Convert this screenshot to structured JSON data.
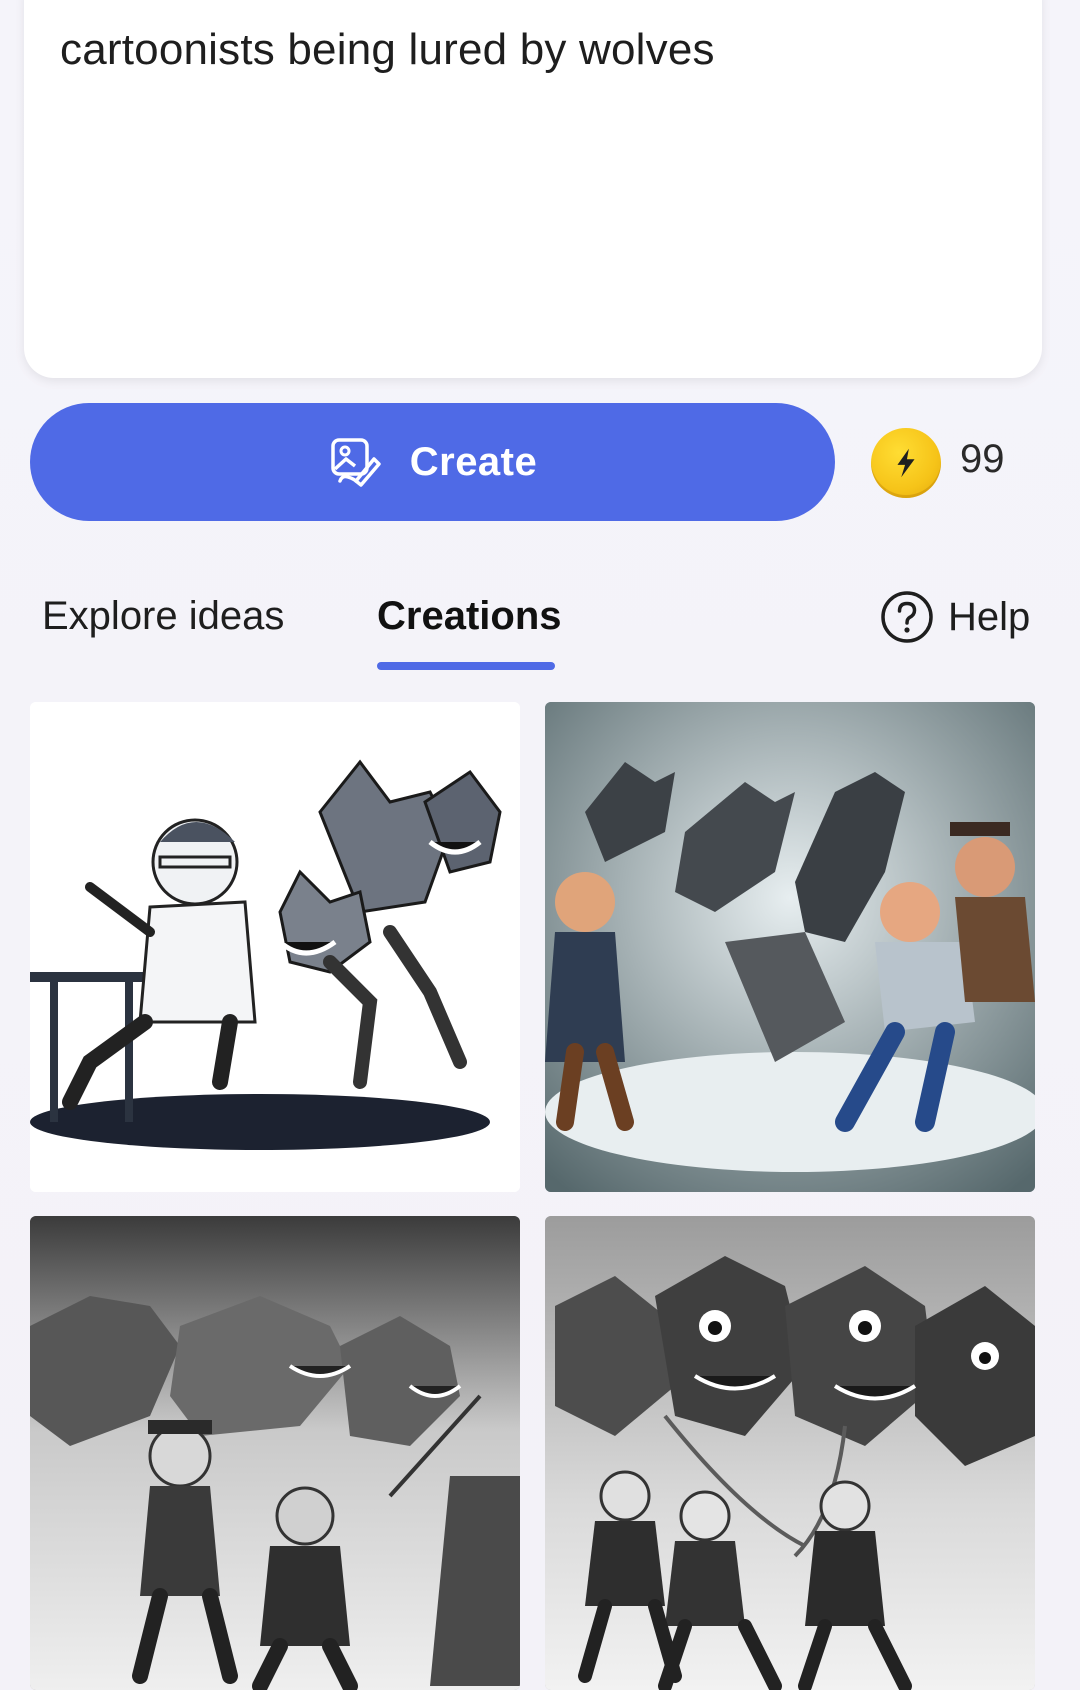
{
  "prompt": {
    "text": "cartoonists being lured by wolves"
  },
  "create": {
    "label": "Create",
    "icon": "image-create-icon",
    "accent_color": "#4f6ae6"
  },
  "boosts": {
    "icon": "lightning-coin-icon",
    "count": "99",
    "coin_color": "#f6c419"
  },
  "tabs": [
    {
      "label": "Explore ideas",
      "active": false
    },
    {
      "label": "Creations",
      "active": true
    }
  ],
  "help": {
    "label": "Help",
    "icon": "question-circle-icon"
  },
  "creations": [
    {
      "kind": "generated-image",
      "palette": "black-and-white line art"
    },
    {
      "kind": "generated-image",
      "palette": "color painting"
    },
    {
      "kind": "generated-image",
      "palette": "grayscale"
    },
    {
      "kind": "generated-image",
      "palette": "grayscale"
    }
  ]
}
